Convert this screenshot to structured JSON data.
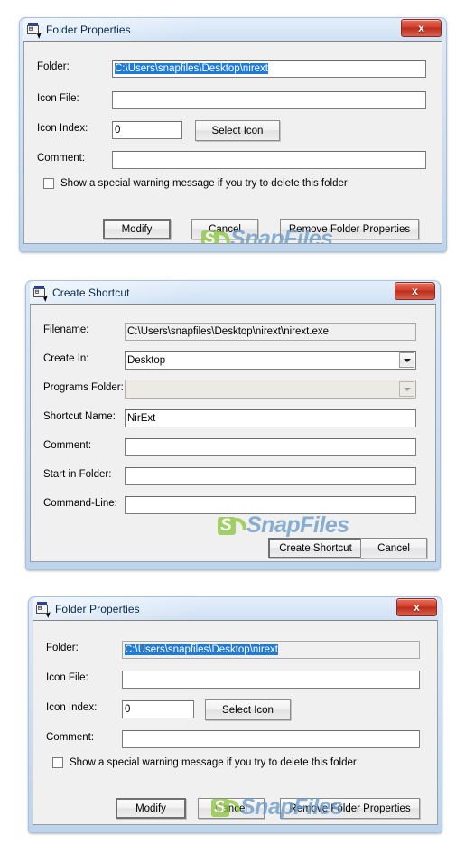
{
  "dialogs": [
    {
      "id": "folder-properties-1",
      "title": "Folder Properties",
      "icon": "nirext-app-icon",
      "close_label": "x",
      "fields": [
        {
          "label": "Folder:",
          "value": "C:\\Users\\snapfiles\\Desktop\\nirext",
          "selected": true,
          "state": "normal"
        },
        {
          "label": "Icon File:",
          "value": "",
          "state": "normal"
        },
        {
          "label": "Icon Index:",
          "value": "0",
          "state": "normal"
        },
        {
          "label": "Comment:",
          "value": "",
          "state": "normal"
        }
      ],
      "select_icon_button": "Select Icon",
      "checkbox": {
        "label": "Show a special warning message if you try to delete this folder",
        "checked": false
      },
      "buttons": [
        {
          "label": "Modify",
          "default": true
        },
        {
          "label": "Cancel",
          "default": false
        },
        {
          "label": "Remove Folder Properties",
          "default": false
        }
      ]
    },
    {
      "id": "create-shortcut",
      "title": "Create Shortcut",
      "icon": "nirext-app-icon",
      "close_label": "x",
      "fields": [
        {
          "label": "Filename:",
          "value": "C:\\Users\\snapfiles\\Desktop\\nirext\\nirext.exe",
          "state": "readonly"
        },
        {
          "label": "Create In:",
          "value": "Desktop",
          "state": "combo"
        },
        {
          "label": "Programs Folder:",
          "value": "",
          "state": "combo-disabled"
        },
        {
          "label": "Shortcut Name:",
          "value": "NirExt",
          "state": "normal"
        },
        {
          "label": "Comment:",
          "value": "",
          "state": "normal"
        },
        {
          "label": "Start in Folder:",
          "value": "",
          "state": "normal"
        },
        {
          "label": "Command-Line:",
          "value": "",
          "state": "normal"
        }
      ],
      "buttons": [
        {
          "label": "Create Shortcut",
          "default": true
        },
        {
          "label": "Cancel",
          "default": false
        }
      ]
    },
    {
      "id": "folder-properties-2",
      "title": "Folder Properties",
      "icon": "nirext-app-icon",
      "close_label": "x",
      "fields": [
        {
          "label": "Folder:",
          "value": "C:\\Users\\snapfiles\\Desktop\\nirext",
          "selected": true,
          "state": "readonly"
        },
        {
          "label": "Icon File:",
          "value": "",
          "state": "normal"
        },
        {
          "label": "Icon Index:",
          "value": "0",
          "state": "normal"
        },
        {
          "label": "Comment:",
          "value": "",
          "state": "normal"
        }
      ],
      "select_icon_button": "Select Icon",
      "checkbox": {
        "label": "Show a special warning message if you try to delete this folder",
        "checked": false
      },
      "buttons": [
        {
          "label": "Modify",
          "default": true
        },
        {
          "label": "Cancel",
          "default": false
        },
        {
          "label": "Remove Folder Properties",
          "default": false
        }
      ]
    }
  ],
  "watermark": {
    "text": "SnapFiles",
    "mark": "S"
  },
  "colors": {
    "title_bar": "#d8e7f7",
    "frame": "#bcd4ec",
    "client": "#f0f0f0",
    "close_button": "#c8301a",
    "selection": "#1f7bd6",
    "watermark_text": "#6a9bc9",
    "watermark_logo": "#8dc63f"
  }
}
